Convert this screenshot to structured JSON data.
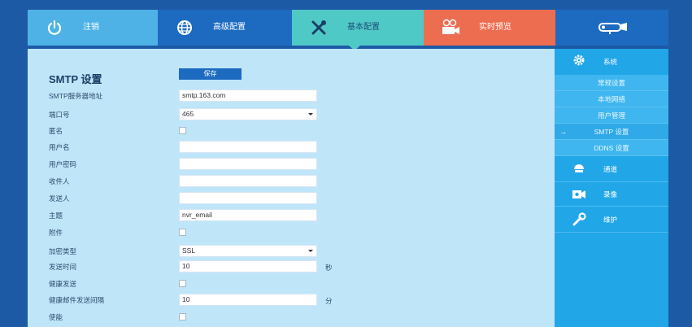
{
  "topnav": {
    "logout": "注销",
    "advanced": "高级配置",
    "basic": "基本配置",
    "live": "实时预览"
  },
  "main": {
    "title": "SMTP 设置",
    "save_label": "保存",
    "fields": {
      "smtp_server": {
        "label": "SMTP服务器地址",
        "value": "smtp.163.com"
      },
      "port": {
        "label": "端口号",
        "value": "465"
      },
      "anonymous": {
        "label": "匿名"
      },
      "username": {
        "label": "用户名",
        "value": ""
      },
      "password": {
        "label": "用户密码",
        "value": ""
      },
      "recipient": {
        "label": "收件人",
        "value": ""
      },
      "sender": {
        "label": "发送人",
        "value": ""
      },
      "subject": {
        "label": "主题",
        "value": "nvr_email"
      },
      "attachment": {
        "label": "附件"
      },
      "encryption": {
        "label": "加密类型",
        "value": "SSL"
      },
      "send_time": {
        "label": "发送时间",
        "value": "10",
        "unit": "秒"
      },
      "health_send": {
        "label": "健康发送"
      },
      "health_interval": {
        "label": "健康邮件发送间隔",
        "value": "10",
        "unit": "分"
      },
      "enable": {
        "label": "使能"
      }
    }
  },
  "sidebar": {
    "system": "系统",
    "items": [
      "常规设置",
      "本地网络",
      "用户管理",
      "SMTP 设置",
      "DDNS 设置"
    ],
    "active_arrow": "→",
    "channel": "通道",
    "record": "录像",
    "maintenance": "维护"
  },
  "colors": {
    "background": "#1c5aa5",
    "logout_tab": "#4eb2e6",
    "advanced_tab": "#1d6bc1",
    "basic_tab": "#4fc9c6",
    "live_tab": "#ed6d50",
    "content": "#bfe5f9",
    "sidebar": "#21a6e8"
  },
  "icons": {
    "logout": "power-icon",
    "advanced": "globe-icon",
    "basic": "tools-icon",
    "live": "video-camera-icon",
    "logo": "security-camera-icon",
    "system": "gear-icon",
    "channel": "dome-camera-icon",
    "record": "record-camera-icon",
    "maintenance": "wrench-icon"
  }
}
